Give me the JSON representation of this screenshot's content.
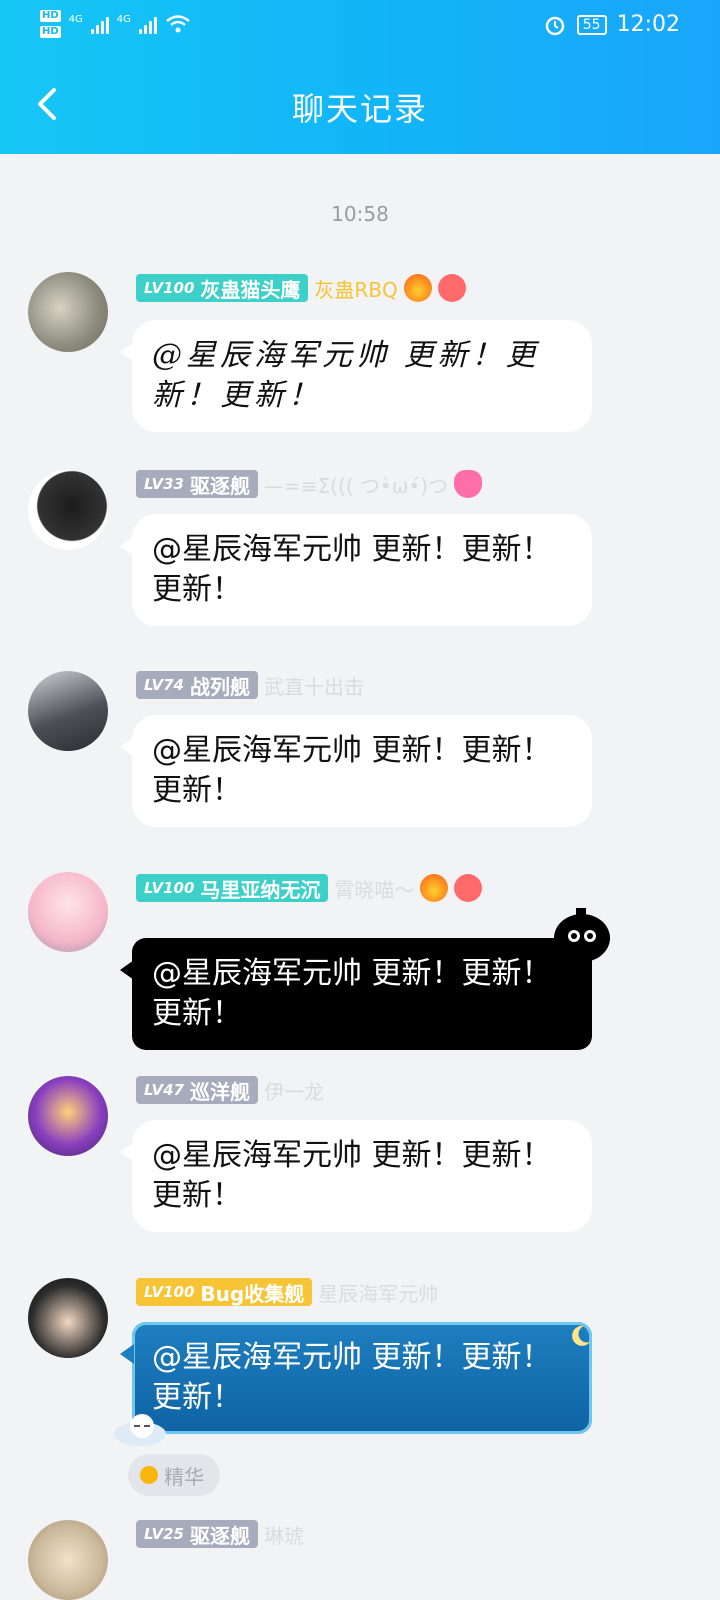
{
  "status_bar": {
    "hd1": "HD",
    "hd2": "HD",
    "net1": "4G",
    "net2": "4G",
    "battery": "55",
    "time": "12:02"
  },
  "nav": {
    "title": "聊天记录"
  },
  "time_separator": "10:58",
  "messages": [
    {
      "lv": "LV100",
      "name": "灰蛊猫头鹰",
      "title": "灰蛊RBQ",
      "text": "@星辰海军元帅 更新！更新！更新！"
    },
    {
      "lv": "LV33",
      "name": "驱逐舰",
      "title": "—=≡Σ((( つ•̀ω•́)つ",
      "text": "@星辰海军元帅 更新！更新！更新！"
    },
    {
      "lv": "LV74",
      "name": "战列舰",
      "title": "武直十出击",
      "text": "@星辰海军元帅 更新！更新！更新！"
    },
    {
      "lv": "LV100",
      "name": "马里亚纳无沉",
      "title": "霄晓喵～",
      "text": "@星辰海军元帅 更新！更新！更新！"
    },
    {
      "lv": "LV47",
      "name": "巡洋舰",
      "title": "伊一龙",
      "text": "@星辰海军元帅 更新！更新！更新！"
    },
    {
      "lv": "LV100",
      "name": "Bug收集舰",
      "title": "星辰海军元帅",
      "text": "@星辰海军元帅 更新！更新！更新！"
    },
    {
      "lv": "LV25",
      "name": "驱逐舰",
      "title": "琳琥",
      "text": ""
    }
  ],
  "essence_label": "精华"
}
